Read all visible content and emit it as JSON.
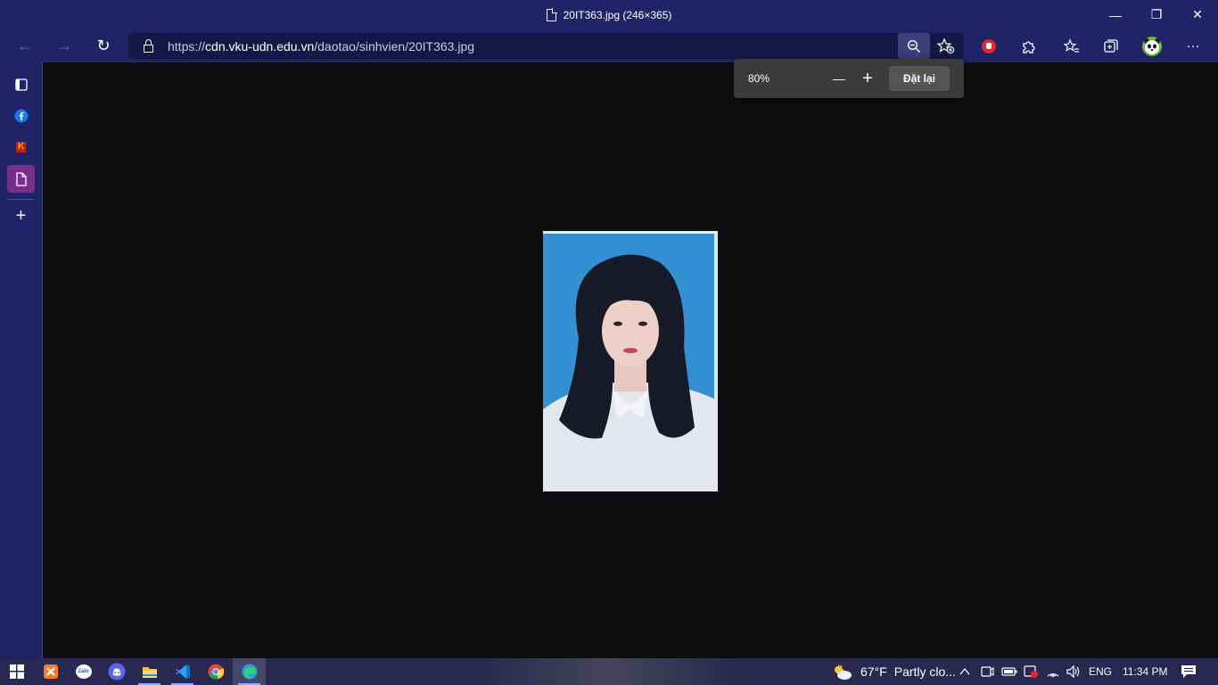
{
  "window": {
    "title": "20IT363.jpg (246×365)",
    "minimize_glyph": "—",
    "restore_glyph": "❐",
    "close_glyph": "✕"
  },
  "toolbar": {
    "back_glyph": "←",
    "forward_glyph": "→",
    "refresh_glyph": "↻",
    "url_scheme": "https://",
    "url_host": "cdn.vku-udn.edu.vn",
    "url_path": "/daotao/sinhvien/20IT363.jpg",
    "more_glyph": "···"
  },
  "zoom_popup": {
    "zoom_level": "80%",
    "zoom_out_glyph": "—",
    "zoom_in_glyph": "+",
    "reset_label": "Đặt lại"
  },
  "sidebar": {
    "add_glyph": "+",
    "items": [
      {
        "name": "tab-actions",
        "icon": "tabs-icon"
      },
      {
        "name": "facebook",
        "icon": "facebook-icon"
      },
      {
        "name": "vku",
        "icon": "vku-icon",
        "label": "K"
      },
      {
        "name": "current-page",
        "icon": "page-icon"
      }
    ]
  },
  "taskbar": {
    "apps": [
      "windows-start",
      "xampp",
      "zalo",
      "discord",
      "file-explorer",
      "vscode",
      "chrome",
      "edge"
    ],
    "zalo_label": "Zalo",
    "weather_temp": "67°F",
    "weather_text": "Partly clo...",
    "language": "ENG",
    "time": "11:34 PM",
    "chevron": "^"
  },
  "colors": {
    "titlebar": "#1f2468",
    "content_bg": "#0e0e10",
    "sidebar_active": "#7a2d8c",
    "popup_bg": "#3b3b3b"
  }
}
